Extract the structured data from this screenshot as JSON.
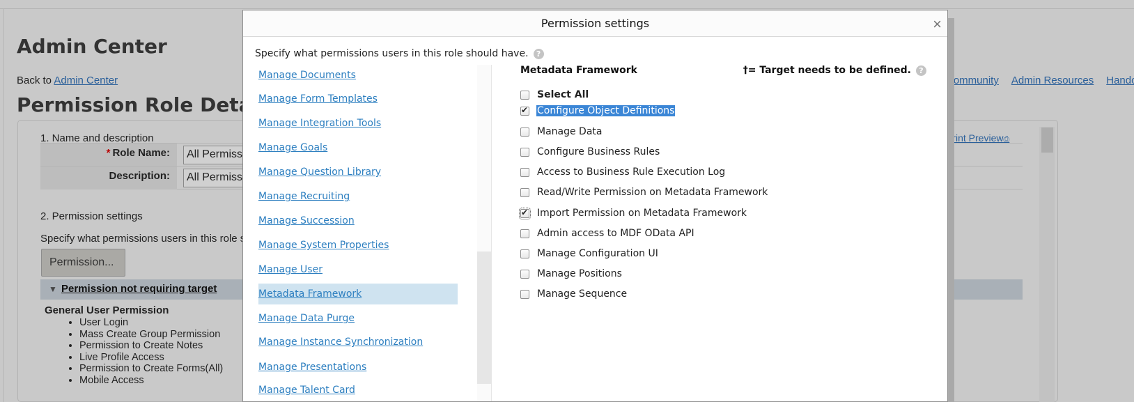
{
  "background": {
    "title": "Admin Center",
    "back_prefix": "Back to",
    "back_link": "Admin Center",
    "top_links": [
      "Community",
      "Admin Resources",
      "Handou"
    ],
    "page_heading": "Permission Role Detail",
    "section1": "1. Name and description",
    "print_preview": "Print Preview",
    "role_name_label": "Role Name:",
    "role_name_value": "All Permissi",
    "description_label": "Description:",
    "description_value": "All Permissi",
    "section2": "2. Permission settings",
    "specify_text": "Specify what permissions users in this role s",
    "permission_button": "Permission...",
    "bar_label": "Permission not requiring target",
    "general_heading": "General User Permission",
    "general_list": [
      "User Login",
      "Mass Create Group Permission",
      "Permission to Create Notes",
      "Live Profile Access",
      "Permission to Create Forms(All)",
      "Mobile Access"
    ]
  },
  "modal": {
    "title": "Permission settings",
    "close": "×",
    "intro": "Specify what permissions users in this role should have.",
    "help_glyph": "?",
    "categories": [
      {
        "label": "Manage Documents",
        "selected": false
      },
      {
        "label": "Manage Form Templates",
        "selected": false
      },
      {
        "label": "Manage Integration Tools",
        "selected": false
      },
      {
        "label": "Manage Goals",
        "selected": false
      },
      {
        "label": "Manage Question Library",
        "selected": false
      },
      {
        "label": "Manage Recruiting",
        "selected": false
      },
      {
        "label": "Manage Succession",
        "selected": false
      },
      {
        "label": "Manage System Properties",
        "selected": false
      },
      {
        "label": "Manage User",
        "selected": false
      },
      {
        "label": "Metadata Framework",
        "selected": true
      },
      {
        "label": "Manage Data Purge",
        "selected": false
      },
      {
        "label": "Manage Instance Synchronization",
        "selected": false
      },
      {
        "label": "Manage Presentations",
        "selected": false
      },
      {
        "label": "Manage Talent Card",
        "selected": false
      }
    ],
    "section_title": "Metadata Framework",
    "target_note": "†= Target needs to be defined.",
    "select_all": "Select All",
    "permissions": [
      {
        "label": "Configure Object Definitions",
        "checked": true
      },
      {
        "label": "Manage Data",
        "checked": false
      },
      {
        "label": "Configure Business Rules",
        "checked": false
      },
      {
        "label": "Access to Business Rule Execution Log",
        "checked": false
      },
      {
        "label": "Read/Write Permission on Metadata Framework",
        "checked": false
      },
      {
        "label": "Import Permission on Metadata Framework",
        "checked": true
      },
      {
        "label": "Admin access to MDF OData API",
        "checked": false
      },
      {
        "label": "Manage Configuration UI",
        "checked": false
      },
      {
        "label": "Manage Positions",
        "checked": false
      },
      {
        "label": "Manage Sequence",
        "checked": false
      }
    ]
  }
}
